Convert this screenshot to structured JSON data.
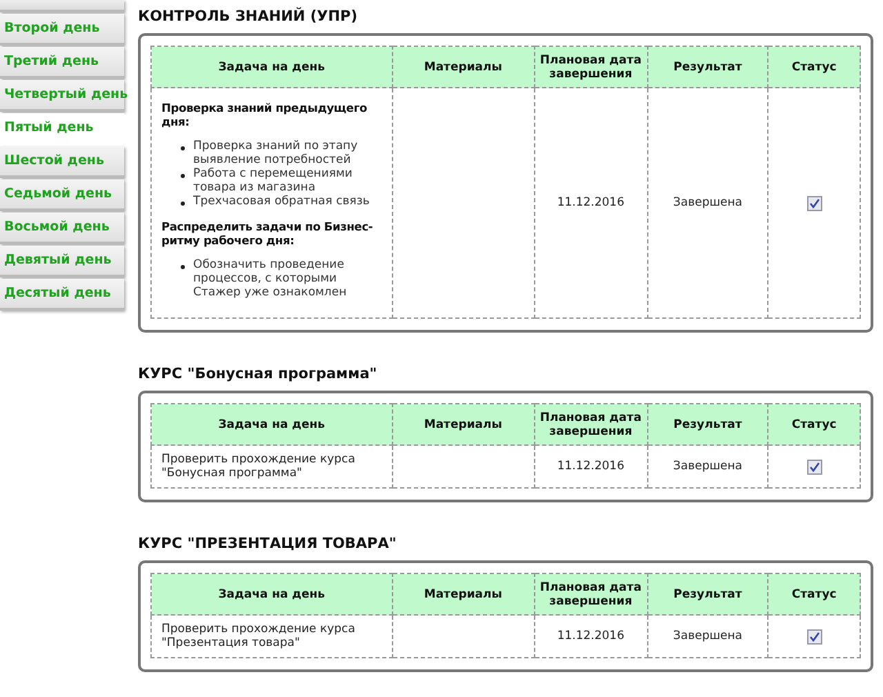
{
  "sidebar": {
    "items": [
      {
        "label": "Второй день",
        "selected": false
      },
      {
        "label": "Третий день",
        "selected": false
      },
      {
        "label": "Четвертый день",
        "selected": false
      },
      {
        "label": "Пятый день",
        "selected": true
      },
      {
        "label": "Шестой день",
        "selected": false
      },
      {
        "label": "Седьмой день",
        "selected": false
      },
      {
        "label": "Восьмой день",
        "selected": false
      },
      {
        "label": "Девятый день",
        "selected": false
      },
      {
        "label": "Десятый день",
        "selected": false
      }
    ]
  },
  "sections": [
    {
      "title": "КОНТРОЛЬ ЗНАНИЙ (УПР)",
      "columns": [
        "Задача на день",
        "Материалы",
        "Плановая дата завершения",
        "Результат",
        "Статус"
      ],
      "rows": [
        {
          "task": {
            "kind": "outline",
            "blocks": [
              {
                "heading": "Проверка знаний предыдущего дня:",
                "items": [
                  "Проверка знаний по этапу выявление потребностей",
                  "Работа с перемещениями товара из магазина",
                  "Трехчасовая обратная связь"
                ]
              },
              {
                "heading": "Распределить задачи по Бизнес-ритму рабочего дня:",
                "items": [
                  "Обозначить проведение процессов, с которыми Стажер уже ознакомлен"
                ]
              }
            ]
          },
          "date": "11.12.2016",
          "result": "Завершена",
          "checked": true
        }
      ]
    },
    {
      "title": "КУРС \"Бонусная программа\"",
      "columns": [
        "Задача на день",
        "Материалы",
        "Плановая дата завершения",
        "Результат",
        "Статус"
      ],
      "rows": [
        {
          "task": {
            "kind": "text",
            "text": "Проверить прохождение курса \"Бонусная программа\""
          },
          "date": "11.12.2016",
          "result": "Завершена",
          "checked": true
        }
      ]
    },
    {
      "title": "КУРС \"ПРЕЗЕНТАЦИЯ ТОВАРА\"",
      "columns": [
        "Задача на день",
        "Материалы",
        "Плановая дата завершения",
        "Результат",
        "Статус"
      ],
      "rows": [
        {
          "task": {
            "kind": "text",
            "text": "Проверить прохождение курса \"Презентация товара\""
          },
          "date": "11.12.2016",
          "result": "Завершена",
          "checked": true
        }
      ]
    }
  ]
}
